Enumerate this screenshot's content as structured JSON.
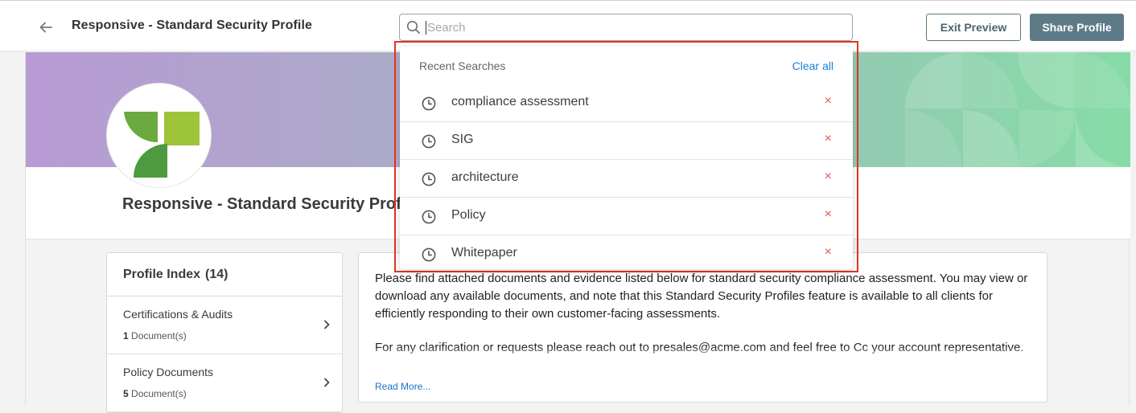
{
  "header": {
    "title": "Responsive - Standard Security Profile",
    "search_placeholder": "Search",
    "search_value": "",
    "exit_label": "Exit Preview",
    "share_label": "Share Profile"
  },
  "profile": {
    "name": "Responsive - Standard Security Profile"
  },
  "recent_searches": {
    "title": "Recent Searches",
    "clear_label": "Clear all",
    "remove_glyph": "×",
    "items": [
      {
        "label": "compliance assessment"
      },
      {
        "label": "SIG"
      },
      {
        "label": "architecture"
      },
      {
        "label": "Policy"
      },
      {
        "label": "Whitepaper"
      }
    ]
  },
  "profile_index": {
    "title": "Profile Index",
    "count": "(14)",
    "items": [
      {
        "label": "Certifications & Audits",
        "doc_count": "1",
        "doc_suffix": "Document(s)"
      },
      {
        "label": "Policy Documents",
        "doc_count": "5",
        "doc_suffix": "Document(s)"
      }
    ]
  },
  "description": {
    "paragraph1": "Please find attached documents and evidence listed below for standard security compliance assessment. You may view or download any available documents, and note that this Standard Security Profiles feature is available to all clients for efficiently responding to their own customer-facing assessments.",
    "paragraph2": "For any clarification or requests please reach out to presales@acme.com and feel free to Cc your account representative.",
    "read_more": "Read More..."
  },
  "colors": {
    "highlight": "#e0351f",
    "link": "#1a7ed6",
    "remove": "#e05555",
    "share_bg": "#5e7a87"
  }
}
